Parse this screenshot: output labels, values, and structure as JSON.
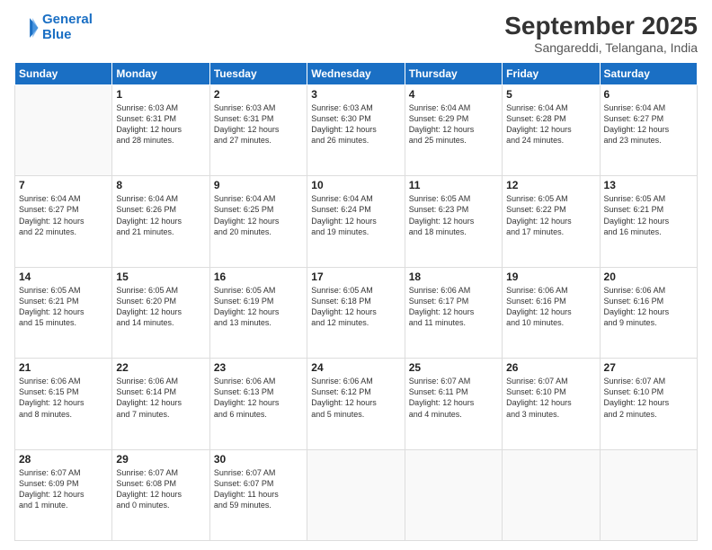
{
  "header": {
    "logo_line1": "General",
    "logo_line2": "Blue",
    "month": "September 2025",
    "location": "Sangareddi, Telangana, India"
  },
  "weekdays": [
    "Sunday",
    "Monday",
    "Tuesday",
    "Wednesday",
    "Thursday",
    "Friday",
    "Saturday"
  ],
  "weeks": [
    [
      {
        "day": "",
        "info": ""
      },
      {
        "day": "1",
        "info": "Sunrise: 6:03 AM\nSunset: 6:31 PM\nDaylight: 12 hours\nand 28 minutes."
      },
      {
        "day": "2",
        "info": "Sunrise: 6:03 AM\nSunset: 6:31 PM\nDaylight: 12 hours\nand 27 minutes."
      },
      {
        "day": "3",
        "info": "Sunrise: 6:03 AM\nSunset: 6:30 PM\nDaylight: 12 hours\nand 26 minutes."
      },
      {
        "day": "4",
        "info": "Sunrise: 6:04 AM\nSunset: 6:29 PM\nDaylight: 12 hours\nand 25 minutes."
      },
      {
        "day": "5",
        "info": "Sunrise: 6:04 AM\nSunset: 6:28 PM\nDaylight: 12 hours\nand 24 minutes."
      },
      {
        "day": "6",
        "info": "Sunrise: 6:04 AM\nSunset: 6:27 PM\nDaylight: 12 hours\nand 23 minutes."
      }
    ],
    [
      {
        "day": "7",
        "info": "Sunrise: 6:04 AM\nSunset: 6:27 PM\nDaylight: 12 hours\nand 22 minutes."
      },
      {
        "day": "8",
        "info": "Sunrise: 6:04 AM\nSunset: 6:26 PM\nDaylight: 12 hours\nand 21 minutes."
      },
      {
        "day": "9",
        "info": "Sunrise: 6:04 AM\nSunset: 6:25 PM\nDaylight: 12 hours\nand 20 minutes."
      },
      {
        "day": "10",
        "info": "Sunrise: 6:04 AM\nSunset: 6:24 PM\nDaylight: 12 hours\nand 19 minutes."
      },
      {
        "day": "11",
        "info": "Sunrise: 6:05 AM\nSunset: 6:23 PM\nDaylight: 12 hours\nand 18 minutes."
      },
      {
        "day": "12",
        "info": "Sunrise: 6:05 AM\nSunset: 6:22 PM\nDaylight: 12 hours\nand 17 minutes."
      },
      {
        "day": "13",
        "info": "Sunrise: 6:05 AM\nSunset: 6:21 PM\nDaylight: 12 hours\nand 16 minutes."
      }
    ],
    [
      {
        "day": "14",
        "info": "Sunrise: 6:05 AM\nSunset: 6:21 PM\nDaylight: 12 hours\nand 15 minutes."
      },
      {
        "day": "15",
        "info": "Sunrise: 6:05 AM\nSunset: 6:20 PM\nDaylight: 12 hours\nand 14 minutes."
      },
      {
        "day": "16",
        "info": "Sunrise: 6:05 AM\nSunset: 6:19 PM\nDaylight: 12 hours\nand 13 minutes."
      },
      {
        "day": "17",
        "info": "Sunrise: 6:05 AM\nSunset: 6:18 PM\nDaylight: 12 hours\nand 12 minutes."
      },
      {
        "day": "18",
        "info": "Sunrise: 6:06 AM\nSunset: 6:17 PM\nDaylight: 12 hours\nand 11 minutes."
      },
      {
        "day": "19",
        "info": "Sunrise: 6:06 AM\nSunset: 6:16 PM\nDaylight: 12 hours\nand 10 minutes."
      },
      {
        "day": "20",
        "info": "Sunrise: 6:06 AM\nSunset: 6:16 PM\nDaylight: 12 hours\nand 9 minutes."
      }
    ],
    [
      {
        "day": "21",
        "info": "Sunrise: 6:06 AM\nSunset: 6:15 PM\nDaylight: 12 hours\nand 8 minutes."
      },
      {
        "day": "22",
        "info": "Sunrise: 6:06 AM\nSunset: 6:14 PM\nDaylight: 12 hours\nand 7 minutes."
      },
      {
        "day": "23",
        "info": "Sunrise: 6:06 AM\nSunset: 6:13 PM\nDaylight: 12 hours\nand 6 minutes."
      },
      {
        "day": "24",
        "info": "Sunrise: 6:06 AM\nSunset: 6:12 PM\nDaylight: 12 hours\nand 5 minutes."
      },
      {
        "day": "25",
        "info": "Sunrise: 6:07 AM\nSunset: 6:11 PM\nDaylight: 12 hours\nand 4 minutes."
      },
      {
        "day": "26",
        "info": "Sunrise: 6:07 AM\nSunset: 6:10 PM\nDaylight: 12 hours\nand 3 minutes."
      },
      {
        "day": "27",
        "info": "Sunrise: 6:07 AM\nSunset: 6:10 PM\nDaylight: 12 hours\nand 2 minutes."
      }
    ],
    [
      {
        "day": "28",
        "info": "Sunrise: 6:07 AM\nSunset: 6:09 PM\nDaylight: 12 hours\nand 1 minute."
      },
      {
        "day": "29",
        "info": "Sunrise: 6:07 AM\nSunset: 6:08 PM\nDaylight: 12 hours\nand 0 minutes."
      },
      {
        "day": "30",
        "info": "Sunrise: 6:07 AM\nSunset: 6:07 PM\nDaylight: 11 hours\nand 59 minutes."
      },
      {
        "day": "",
        "info": ""
      },
      {
        "day": "",
        "info": ""
      },
      {
        "day": "",
        "info": ""
      },
      {
        "day": "",
        "info": ""
      }
    ]
  ]
}
